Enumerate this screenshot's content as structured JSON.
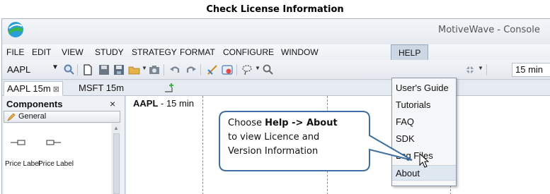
{
  "document": {
    "title": "Check License Information"
  },
  "window": {
    "app_title": "MotiveWave - Console",
    "logo": "motivewave-logo-icon"
  },
  "menubar": {
    "items": [
      "FILE",
      "EDIT",
      "VIEW",
      "STUDY",
      "STRATEGY",
      "FORMAT",
      "CONFIGURE",
      "WINDOW",
      "HELP"
    ],
    "open_menu": "HELP"
  },
  "toolbar": {
    "symbol": "AAPL",
    "period": "15 min",
    "icons": [
      "search-icon",
      "new-page-icon",
      "save-icon",
      "save-as-icon",
      "open-folder-icon",
      "camera-icon",
      "undo-icon",
      "redo-icon",
      "draw-line-icon",
      "alarm-icon",
      "lasso-icon",
      "zoom-icon",
      "component-icon"
    ]
  },
  "tabs": [
    {
      "label": "AAPL 15m",
      "active": true,
      "close": "⊠"
    },
    {
      "label": "MSFT 15m",
      "active": false
    }
  ],
  "components_panel": {
    "title": "Components",
    "close": "×",
    "section": "General",
    "items": [
      {
        "label": "Price Label"
      },
      {
        "label": "Price Label"
      }
    ]
  },
  "chart": {
    "symbol": "AAPL",
    "separator": " - ",
    "period": "15 min"
  },
  "help_menu": {
    "items": [
      "User's Guide",
      "Tutorials",
      "FAQ",
      "SDK",
      "Log Files",
      "About"
    ],
    "hovered": "About"
  },
  "callout": {
    "prefix": "Choose ",
    "command": "Help -> About",
    "line2": "to view Licence and",
    "line3": "Version Information"
  },
  "colors": {
    "callout_border": "#3f6fa1",
    "menu_open_bg": "#ccd7e3",
    "logo_blue": "#2a9fd6",
    "logo_green": "#3ab54a"
  }
}
